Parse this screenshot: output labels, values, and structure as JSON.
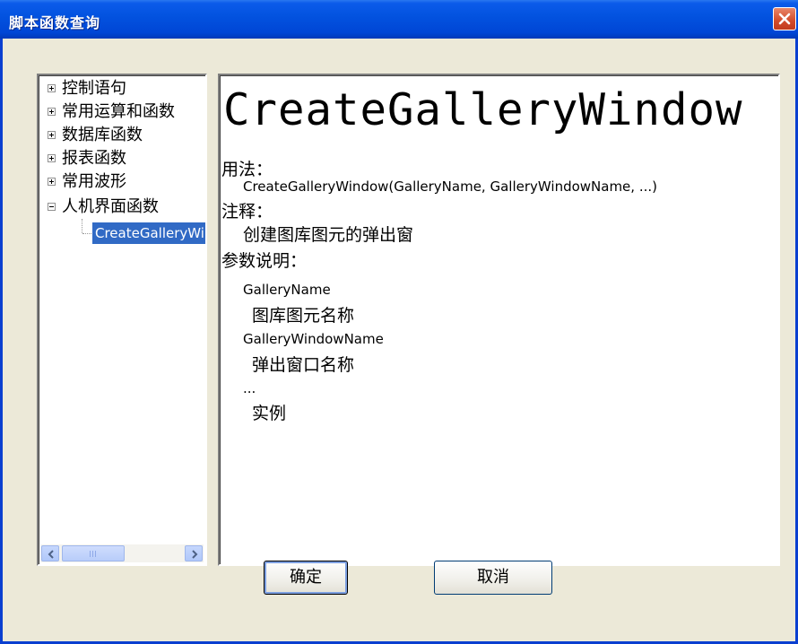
{
  "window": {
    "title": "脚本函数查询"
  },
  "tree": {
    "items": [
      {
        "label": "控制语句",
        "expander": "plus"
      },
      {
        "label": "常用运算和函数",
        "expander": "plus"
      },
      {
        "label": "数据库函数",
        "expander": "plus"
      },
      {
        "label": "报表函数",
        "expander": "plus"
      },
      {
        "label": "常用波形",
        "expander": "plus"
      },
      {
        "label": "人机界面函数",
        "expander": "minus"
      }
    ],
    "selected_child": "CreateGalleryWindow"
  },
  "content": {
    "function_name": "CreateGalleryWindow",
    "usage_label": "用法：",
    "usage": "CreateGalleryWindow(GalleryName, GalleryWindowName, ...)",
    "note_label": "注释：",
    "note": "创建图库图元的弹出窗",
    "params_label": "参数说明：",
    "params": [
      {
        "name": "GalleryName",
        "desc": "图库图元名称"
      },
      {
        "name": "GalleryWindowName",
        "desc": "弹出窗口名称"
      },
      {
        "name": "...",
        "desc": "实例"
      }
    ]
  },
  "buttons": {
    "ok": "确定",
    "cancel": "取消"
  },
  "colors": {
    "selection": "#316ac5",
    "titlebar": "#0054e3",
    "close": "#d24b2a"
  }
}
